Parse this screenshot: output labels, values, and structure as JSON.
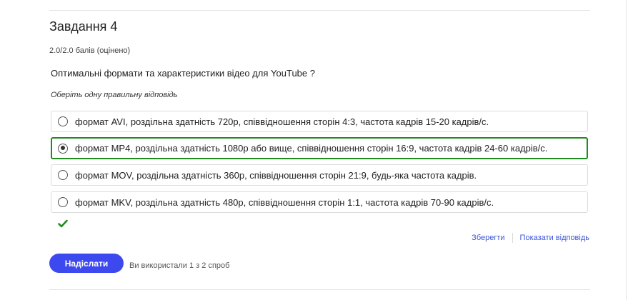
{
  "problem": {
    "title": "Завдання 4",
    "score": "2.0/2.0 балів (оцінено)",
    "question": "Оптимальні формати та характеристики відео для YouTube ?",
    "instruction": "Оберіть одну правильну відповідь"
  },
  "options": [
    {
      "label": "формат AVI, роздільна здатність 720p, співвідношення сторін 4:3, частота кадрів 15-20 кадрів/с.",
      "selected": false
    },
    {
      "label": "формат MP4, роздільна здатність 1080p або вище, співвідношення сторін 16:9, частота кадрів 24-60 кадрів/с.",
      "selected": true
    },
    {
      "label": "формат MOV, роздільна здатність 360p, співвідношення сторін 21:9, будь-яка частота кадрів.",
      "selected": false
    },
    {
      "label": "формат MKV, роздільна здатність 480p, співвідношення сторін 1:1, частота кадрів 70-90 кадрів/с.",
      "selected": false
    }
  ],
  "status": {
    "icon": "checkmark-icon",
    "color": "#1f8a1f"
  },
  "actions": {
    "save_label": "Зберегти",
    "show_answer_label": "Показати відповідь"
  },
  "submit": {
    "label": "Надіслати",
    "attempts_text": "Ви використали 1 з 2 спроб"
  },
  "colors": {
    "accent": "#3d49ef",
    "link": "#3b56d8",
    "correct": "#1f8a1f"
  }
}
